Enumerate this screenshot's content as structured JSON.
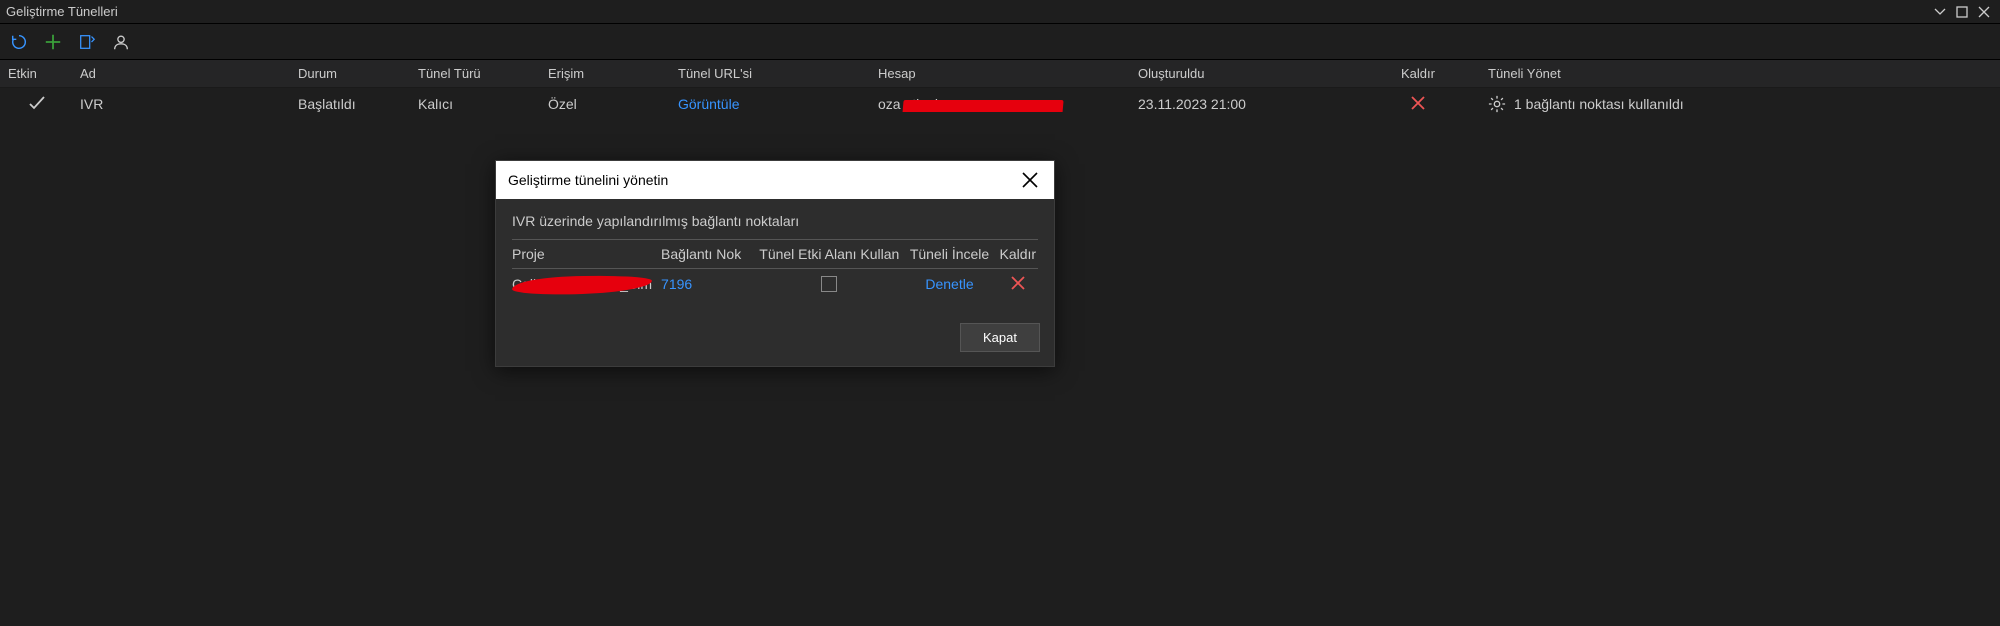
{
  "window": {
    "title": "Geliştirme Tünelleri"
  },
  "toolbar": {
    "refresh_tip": "Yenile",
    "add_tip": "Ekle",
    "edit_tip": "Düzenle",
    "user_tip": "Hesap"
  },
  "table": {
    "headers": {
      "etkin": "Etkin",
      "ad": "Ad",
      "durum": "Durum",
      "tur": "Tünel Türü",
      "erisim": "Erişim",
      "url": "Tünel URL'si",
      "hesap": "Hesap",
      "olustur": "Oluşturuldu",
      "kaldir": "Kaldır",
      "yonet": "Tüneli Yönet"
    },
    "rows": [
      {
        "ad": "IVR",
        "durum": "Başlatıldı",
        "tur": "Kalıcı",
        "erisim": "Özel",
        "url": "Görüntüle",
        "hesap": "oza                          utlook",
        "olustur": "23.11.2023 21:00",
        "yonet": "1 bağlantı noktası kullanıldı"
      }
    ]
  },
  "modal": {
    "title": "Geliştirme tünelini yönetin",
    "subtitle": "IVR üzerinde yapılandırılmış bağlantı noktaları",
    "headers": {
      "proje": "Proje",
      "port": "Bağlantı Nok",
      "domain": "Tünel Etki Alanı Kullan",
      "inspect": "Tüneli İncele",
      "remove": "Kaldır"
    },
    "rows": [
      {
        "proje": "CallA_tor__ration_Sim",
        "port": "7196",
        "domain_checked": false,
        "inspect": "Denetle"
      }
    ],
    "close_btn": "Kapat"
  }
}
